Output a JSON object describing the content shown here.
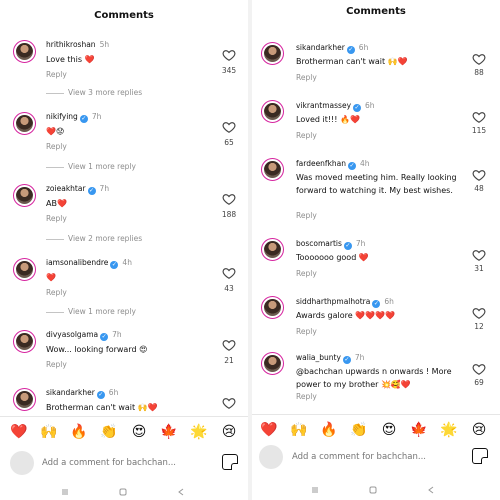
{
  "colors": {
    "heart": "#ed4956",
    "verified": "#3897f0",
    "ring": "#d6249f",
    "muted": "#8e8e8e"
  },
  "left": {
    "title": "Comments",
    "comments": [
      {
        "username": "hrithikroshan",
        "time": "5h",
        "text": "Love this ❤️",
        "reply": "Reply",
        "likes": "345"
      },
      {
        "username": "nikifying",
        "time": "7h",
        "text": "❤️😟",
        "reply": "Reply",
        "likes": "65"
      },
      {
        "username": "zoieakhtar",
        "time": "7h",
        "text": "AB❤️",
        "reply": "Reply",
        "likes": "188"
      },
      {
        "username": "iamsonalibendre",
        "time": "4h",
        "text": "❤️",
        "reply": "Reply",
        "likes": "43"
      },
      {
        "username": "divyasolgama",
        "time": "7h",
        "text": "Wow... looking forward 😍",
        "reply": "Reply",
        "likes": "21"
      },
      {
        "username": "sikandarkher",
        "time": "6h",
        "text": "Brotherman can't wait 🙌❤️",
        "reply": "",
        "likes": ""
      }
    ],
    "more_replies": [
      "View 3 more replies",
      "View 1 more reply",
      "View 2 more replies",
      "View 1 more reply"
    ],
    "emojis": [
      "❤️",
      "🙌",
      "🔥",
      "👏",
      "😍",
      "🍁",
      "🌟",
      "😢"
    ],
    "input_placeholder": "Add a comment for bachchan...",
    "icons": {
      "sticker": "sticker-icon",
      "heart": "heart-outline-icon"
    }
  },
  "right": {
    "title": "Comments",
    "comments": [
      {
        "username": "sikandarkher",
        "time": "6h",
        "text": "Brotherman can't wait 🙌❤️",
        "reply": "Reply",
        "likes": "88"
      },
      {
        "username": "vikrantmassey",
        "time": "6h",
        "text": "Loved it!!! 🔥❤️",
        "reply": "Reply",
        "likes": "115"
      },
      {
        "username": "fardeenfkhan",
        "time": "4h",
        "text": "Was moved meeting him. Really looking forward to watching it.  My best wishes.",
        "reply": "Reply",
        "likes": "48"
      },
      {
        "username": "boscomartis",
        "time": "7h",
        "text": "Tooooooo good ❤️",
        "reply": "Reply",
        "likes": "31"
      },
      {
        "username": "siddharthpmalhotra",
        "time": "6h",
        "text": "Awards galore ❤️❤️❤️❤️",
        "reply": "Reply",
        "likes": "12"
      },
      {
        "username": "walia_bunty",
        "time": "7h",
        "text": "@bachchan upwards n onwards ! More power to my brother 💥🥰❤️",
        "reply": "Reply",
        "likes": "69"
      }
    ],
    "emojis": [
      "❤️",
      "🙌",
      "🔥",
      "👏",
      "😍",
      "🍁",
      "🌟",
      "😢"
    ],
    "input_placeholder": "Add a comment for bachchan..."
  }
}
